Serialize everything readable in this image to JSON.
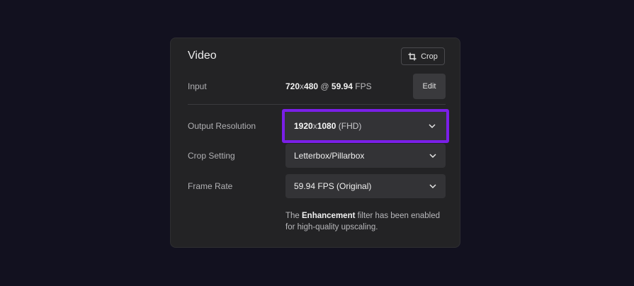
{
  "panel": {
    "title": "Video",
    "crop_label": "Crop"
  },
  "input": {
    "label": "Input",
    "resolution": "720",
    "resolution_x": "x",
    "resolution_h": "480",
    "at": " @ ",
    "fps_value": "59.94",
    "fps_unit": " FPS",
    "edit_label": "Edit"
  },
  "output_resolution": {
    "label": "Output Resolution",
    "value_main": "1920",
    "value_x": "x",
    "value_h": "1080",
    "value_suffix": " (FHD)"
  },
  "crop_setting": {
    "label": "Crop Setting",
    "value": "Letterbox/Pillarbox"
  },
  "frame_rate": {
    "label": "Frame Rate",
    "value": "59.94 FPS (Original)"
  },
  "note": {
    "prefix": "The ",
    "emphasis": "Enhancement",
    "suffix": " filter has been enabled for high-quality upscaling."
  },
  "colors": {
    "background": "#12111f",
    "panel": "#232325",
    "highlight": "#7b1fe8"
  },
  "icons": {
    "crop": "crop-icon",
    "chevron": "chevron-down-icon"
  }
}
